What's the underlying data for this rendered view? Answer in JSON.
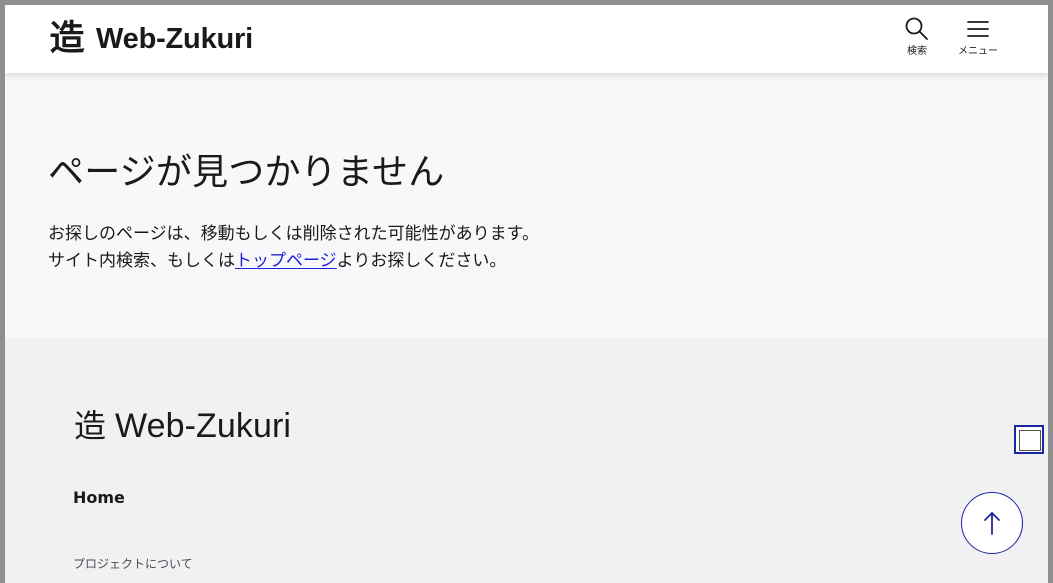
{
  "header": {
    "brand_mark": "造",
    "brand_name": "Web-Zukuri",
    "search_label": "検索",
    "menu_label": "メニュー",
    "icons": {
      "search": "search-icon",
      "menu": "menu-icon"
    }
  },
  "main": {
    "title": "ページが見つかりません",
    "message_line_1": "お探しのページは、移動もしくは削除された可能性があります。",
    "message_line_2_before": "サイト内検索、もしくは",
    "message_link": "トップページ",
    "message_line_2_after": "よりお探しください。"
  },
  "footer": {
    "brand_mark": "造",
    "brand_name": "Web-Zukuri",
    "home_label": "Home",
    "project_label": "プロジェクトについて"
  },
  "colors": {
    "outer_frame": "#8f8f8f",
    "page_background": "#f8f8fb",
    "footer_background": "#f1f1f4",
    "link": "#1a26d8",
    "accent_outline": "#1a26a6"
  }
}
